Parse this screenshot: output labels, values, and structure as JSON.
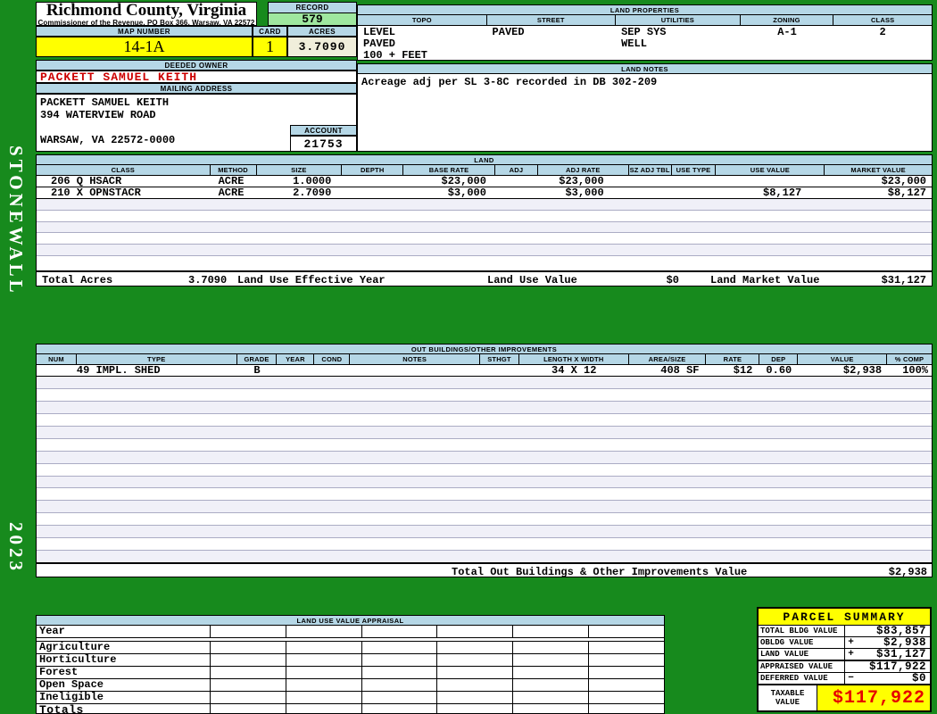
{
  "colors": {
    "page_green": "#178a1d",
    "header_blue": "#b5d7e6",
    "highlight_yellow": "#ffff00",
    "record_green": "#9fe79f",
    "acres_cream": "#f0eedb",
    "owner_red": "#cc0000",
    "taxable_red": "#e60000"
  },
  "sidebar": {
    "district": "STONEWALL",
    "year": "2023"
  },
  "header": {
    "county_title": "Richmond County, Virginia",
    "county_subtitle": "Commissioner of the Revenue, PO Box 366, Warsaw, VA 22572",
    "record_label": "RECORD",
    "record_value": "579",
    "map_number_label": "MAP NUMBER",
    "map_number": "14-1A",
    "card_label": "CARD",
    "card_value": "1",
    "acres_label": "ACRES",
    "acres_value": "3.7090",
    "deeded_owner_label": "DEEDED OWNER",
    "deeded_owner": "PACKETT SAMUEL KEITH",
    "mailing_address_label": "MAILING ADDRESS",
    "mailing_lines": [
      "PACKETT SAMUEL KEITH",
      "394 WATERVIEW ROAD",
      "",
      "WARSAW, VA 22572-0000"
    ],
    "account_label": "ACCOUNT",
    "account_value": "21753"
  },
  "land_properties": {
    "title": "LAND PROPERTIES",
    "columns": [
      "TOPO",
      "STREET",
      "UTILITIES",
      "ZONING",
      "CLASS"
    ],
    "topo": [
      "LEVEL",
      "PAVED",
      "100 + FEET"
    ],
    "street": [
      "PAVED"
    ],
    "utilities": [
      "SEP SYS",
      "WELL"
    ],
    "zoning": [
      "A-1"
    ],
    "class": [
      "2"
    ]
  },
  "land_notes": {
    "title": "LAND NOTES",
    "text": "Acreage adj per SL 3-8C recorded in DB 302-209"
  },
  "land": {
    "title": "LAND",
    "columns": [
      "CLASS",
      "METHOD",
      "SIZE",
      "DEPTH",
      "BASE RATE",
      "ADJ",
      "ADJ RATE",
      "SZ ADJ TBL",
      "USE TYPE",
      "USE VALUE",
      "MARKET VALUE"
    ],
    "rows": [
      {
        "class": "206 Q HSACR",
        "method": "ACRE",
        "size": "1.0000",
        "depth": "",
        "base_rate": "$23,000",
        "adj": "",
        "adj_rate": "$23,000",
        "sz_adj_tbl": "",
        "use_type": "",
        "use_value": "",
        "market_value": "$23,000"
      },
      {
        "class": "210 X OPNSTACR",
        "method": "ACRE",
        "size": "2.7090",
        "depth": "",
        "base_rate": "$3,000",
        "adj": "",
        "adj_rate": "$3,000",
        "sz_adj_tbl": "",
        "use_type": "",
        "use_value": "$8,127",
        "market_value": "$8,127"
      }
    ],
    "totals": {
      "acres_label": "Total Acres",
      "acres": "3.7090",
      "effective_year_label": "Land Use Effective Year",
      "use_value_label": "Land Use Value",
      "use_value": "$0",
      "market_value_label": "Land Market Value",
      "market_value": "$31,127"
    }
  },
  "out_buildings": {
    "title": "OUT BUILDINGS/OTHER IMPROVEMENTS",
    "columns": [
      "NUM",
      "TYPE",
      "GRADE",
      "YEAR",
      "COND",
      "NOTES",
      "STHGT",
      "LENGTH X WIDTH",
      "AREA/SIZE",
      "RATE",
      "DEP",
      "VALUE",
      "% COMP"
    ],
    "rows": [
      {
        "num": "",
        "type": "49 IMPL. SHED",
        "grade": "B",
        "year": "",
        "cond": "",
        "notes": "",
        "sthgt": "",
        "length_width": "34 X 12",
        "area_size": "408 SF",
        "rate": "$12",
        "dep": "0.60",
        "value": "$2,938",
        "comp": "100%"
      }
    ],
    "total_label": "Total Out Buildings & Other Improvements Value",
    "total_value": "$2,938"
  },
  "land_use_appraisal": {
    "title": "LAND USE VALUE APPRAISAL",
    "row_labels": [
      "Year",
      "Agriculture",
      "Horticulture",
      "Forest",
      "Open Space",
      "Ineligible",
      "Totals"
    ]
  },
  "parcel_summary": {
    "title": "PARCEL SUMMARY",
    "rows": [
      {
        "label": "TOTAL BLDG VALUE",
        "op": "",
        "value": "$83,857"
      },
      {
        "label": "OBLDG VALUE",
        "op": "+",
        "value": "$2,938"
      },
      {
        "label": "LAND VALUE",
        "op": "+",
        "value": "$31,127"
      },
      {
        "label": "APPRAISED VALUE",
        "op": "",
        "value": "$117,922"
      },
      {
        "label": "DEFERRED VALUE",
        "op": "−",
        "value": "$0"
      }
    ],
    "taxable_label": "TAXABLE\nVALUE",
    "taxable_value": "$117,922"
  }
}
